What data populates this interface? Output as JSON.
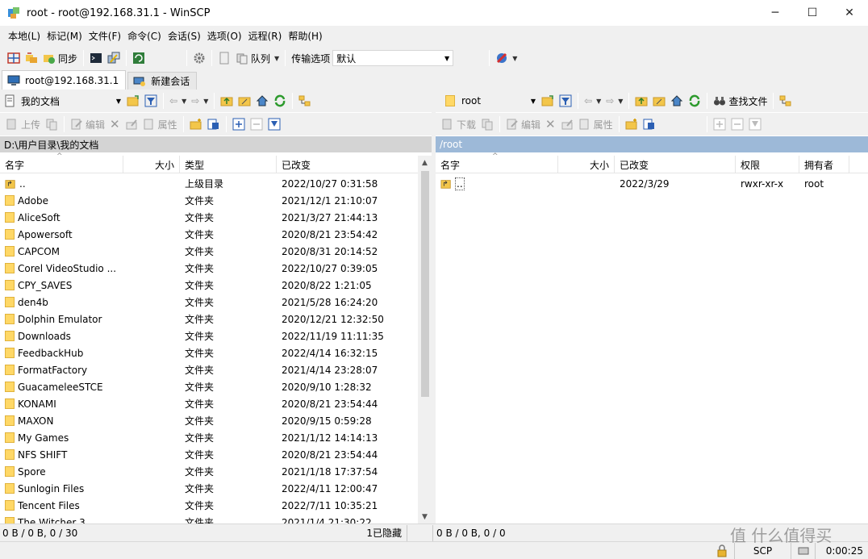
{
  "window": {
    "title": "root - root@192.168.31.1 - WinSCP"
  },
  "menu": [
    "本地(L)",
    "标记(M)",
    "文件(F)",
    "命令(C)",
    "会话(S)",
    "选项(O)",
    "远程(R)",
    "帮助(H)"
  ],
  "toolbar": {
    "sync_label": "同步",
    "queue_label": "队列",
    "transfer_label": "传输选项",
    "transfer_value": "默认"
  },
  "tabs": {
    "session": "root@192.168.31.1",
    "new_session": "新建会话"
  },
  "left": {
    "location": "我的文档",
    "actions": {
      "upload": "上传",
      "edit": "编辑",
      "properties": "属性"
    },
    "path": "D:\\用户目录\\我的文档",
    "columns": [
      "名字",
      "大小",
      "类型",
      "已改变"
    ],
    "rows": [
      {
        "name": "..",
        "type": "上级目录",
        "changed": "2022/10/27  0:31:58",
        "parent": true
      },
      {
        "name": "Adobe",
        "type": "文件夹",
        "changed": "2021/12/1  21:10:07"
      },
      {
        "name": "AliceSoft",
        "type": "文件夹",
        "changed": "2021/3/27  21:44:13"
      },
      {
        "name": "Apowersoft",
        "type": "文件夹",
        "changed": "2020/8/21  23:54:42"
      },
      {
        "name": "CAPCOM",
        "type": "文件夹",
        "changed": "2020/8/31  20:14:52"
      },
      {
        "name": "Corel VideoStudio ...",
        "type": "文件夹",
        "changed": "2022/10/27  0:39:05"
      },
      {
        "name": "CPY_SAVES",
        "type": "文件夹",
        "changed": "2020/8/22  1:21:05"
      },
      {
        "name": "den4b",
        "type": "文件夹",
        "changed": "2021/5/28  16:24:20"
      },
      {
        "name": "Dolphin Emulator",
        "type": "文件夹",
        "changed": "2020/12/21  12:32:50"
      },
      {
        "name": "Downloads",
        "type": "文件夹",
        "changed": "2022/11/19  11:11:35"
      },
      {
        "name": "FeedbackHub",
        "type": "文件夹",
        "changed": "2022/4/14  16:32:15"
      },
      {
        "name": "FormatFactory",
        "type": "文件夹",
        "changed": "2021/4/14  23:28:07"
      },
      {
        "name": "GuacameleeSTCE",
        "type": "文件夹",
        "changed": "2020/9/10  1:28:32"
      },
      {
        "name": "KONAMI",
        "type": "文件夹",
        "changed": "2020/8/21  23:54:44"
      },
      {
        "name": "MAXON",
        "type": "文件夹",
        "changed": "2020/9/15  0:59:28"
      },
      {
        "name": "My Games",
        "type": "文件夹",
        "changed": "2021/1/12  14:14:13"
      },
      {
        "name": "NFS SHIFT",
        "type": "文件夹",
        "changed": "2020/8/21  23:54:44"
      },
      {
        "name": "Spore",
        "type": "文件夹",
        "changed": "2021/1/18  17:37:54"
      },
      {
        "name": "Sunlogin Files",
        "type": "文件夹",
        "changed": "2022/4/11  12:00:47"
      },
      {
        "name": "Tencent Files",
        "type": "文件夹",
        "changed": "2022/7/11  10:35:21"
      },
      {
        "name": "The Witcher 3",
        "type": "文件夹",
        "changed": "2021/1/4  21:30:22"
      }
    ],
    "status": "0 B / 0 B,  0 / 30",
    "hidden": "1已隐藏"
  },
  "right": {
    "location": "root",
    "find_label": "查找文件",
    "actions": {
      "download": "下载",
      "edit": "编辑",
      "properties": "属性"
    },
    "path": "/root",
    "columns": [
      "名字",
      "大小",
      "已改变",
      "权限",
      "拥有者"
    ],
    "rows": [
      {
        "name": "..",
        "changed": "2022/3/29",
        "perm": "rwxr-xr-x",
        "owner": "root"
      }
    ],
    "status": "0 B / 0 B,  0 / 0"
  },
  "statusbar": {
    "protocol": "SCP",
    "time": "0:00:25"
  },
  "watermark": "值 什么值得买",
  "colors": {
    "remote_path_bg": "#9db9d8",
    "local_path_bg": "#d4d4d4",
    "folder": "#ffd866"
  }
}
